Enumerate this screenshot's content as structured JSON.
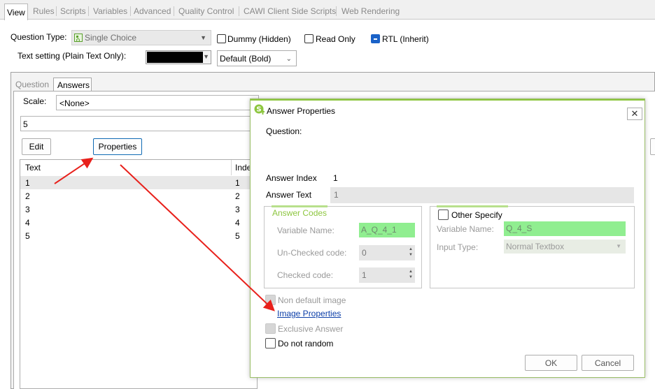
{
  "top_tabs": [
    "View",
    "Rules",
    "Scripts",
    "Variables",
    "Advanced",
    "Quality Control",
    "CAWI Client Side Scripts",
    "Web Rendering"
  ],
  "question_type": {
    "label": "Question Type:",
    "value": "Single Choice"
  },
  "checkboxes": {
    "dummy": "Dummy (Hidden)",
    "read_only": "Read Only",
    "rtl": "RTL (Inherit)"
  },
  "text_setting": {
    "label": "Text setting (Plain Text Only):",
    "style_value": "Default (Bold)"
  },
  "sub_tabs": [
    "Question",
    "Answers"
  ],
  "scale": {
    "label": "Scale:",
    "value": "<None>"
  },
  "count_value": "5",
  "buttons": {
    "edit": "Edit",
    "properties": "Properties"
  },
  "grid": {
    "columns": [
      "Text",
      "Inde"
    ],
    "rows": [
      [
        "1",
        "1"
      ],
      [
        "2",
        "2"
      ],
      [
        "3",
        "3"
      ],
      [
        "4",
        "4"
      ],
      [
        "5",
        "5"
      ]
    ]
  },
  "dialog": {
    "title": "Answer Properties",
    "question_label": "Question:",
    "answer_index_label": "Answer Index",
    "answer_index_value": "1",
    "answer_text_label": "Answer Text",
    "answer_text_value": "1",
    "answer_codes": {
      "title": "Answer Codes",
      "variable_name_label": "Variable Name:",
      "variable_name_value": "A_Q_4_1",
      "unchecked_label": "Un-Checked code:",
      "unchecked_value": "0",
      "checked_label": "Checked code:",
      "checked_value": "1"
    },
    "other_specify": {
      "title": "Other Specify",
      "variable_name_label": "Variable Name:",
      "variable_name_value": "Q_4_S",
      "input_type_label": "Input Type:",
      "input_type_value": "Normal Textbox"
    },
    "non_default_image": "Non default image",
    "image_properties": "Image Properties",
    "exclusive_answer": "Exclusive Answer",
    "do_not_random": "Do not random",
    "ok": "OK",
    "cancel": "Cancel"
  },
  "colors": {
    "arrow": "#e8201b",
    "accent_green": "#8dc63f",
    "field_green": "#90ee90",
    "rtl_blue": "#1a62c8"
  }
}
